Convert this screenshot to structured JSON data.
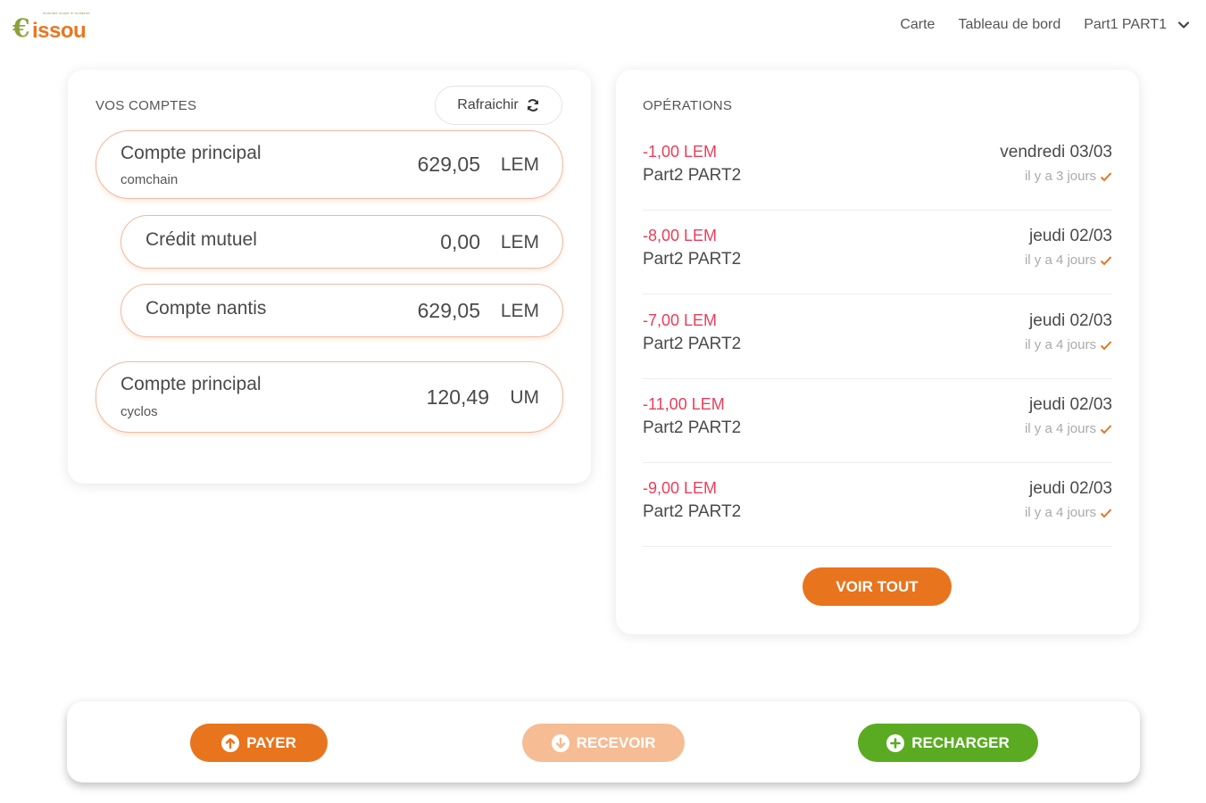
{
  "header": {
    "logo_tagline": "monnaie locale et solidaire",
    "logo_text": "issou",
    "nav": [
      "Carte",
      "Tableau de bord"
    ],
    "user": "Part1 PART1"
  },
  "accounts": {
    "title": "VOS COMPTES",
    "refresh_label": "Rafraichir",
    "items": [
      {
        "name": "Compte principal",
        "sub": "comchain",
        "amount": "629,05",
        "currency": "LEM"
      },
      {
        "name": "Crédit mutuel",
        "sub": "",
        "amount": "0,00",
        "currency": "LEM"
      },
      {
        "name": "Compte nantis",
        "sub": "",
        "amount": "629,05",
        "currency": "LEM"
      },
      {
        "name": "Compte principal",
        "sub": "cyclos",
        "amount": "120,49",
        "currency": "UM"
      }
    ]
  },
  "operations": {
    "title": "OPÉRATIONS",
    "items": [
      {
        "amount": "-1,00 LEM",
        "party": "Part2 PART2",
        "date": "vendredi 03/03",
        "relative": "il y a 3 jours"
      },
      {
        "amount": "-8,00 LEM",
        "party": "Part2 PART2",
        "date": "jeudi 02/03",
        "relative": "il y a 4 jours"
      },
      {
        "amount": "-7,00 LEM",
        "party": "Part2 PART2",
        "date": "jeudi 02/03",
        "relative": "il y a 4 jours"
      },
      {
        "amount": "-11,00 LEM",
        "party": "Part2 PART2",
        "date": "jeudi 02/03",
        "relative": "il y a 4 jours"
      },
      {
        "amount": "-9,00 LEM",
        "party": "Part2 PART2",
        "date": "jeudi 02/03",
        "relative": "il y a 4 jours"
      }
    ],
    "see_all_label": "VOIR TOUT"
  },
  "actions": {
    "pay_label": "PAYER",
    "receive_label": "RECEVOIR",
    "reload_label": "RECHARGER"
  },
  "colors": {
    "brand_orange": "#e8741e",
    "brand_orange_light": "#f6bc94",
    "brand_green": "#5aab22",
    "negative_amount": "#e83e5a"
  }
}
